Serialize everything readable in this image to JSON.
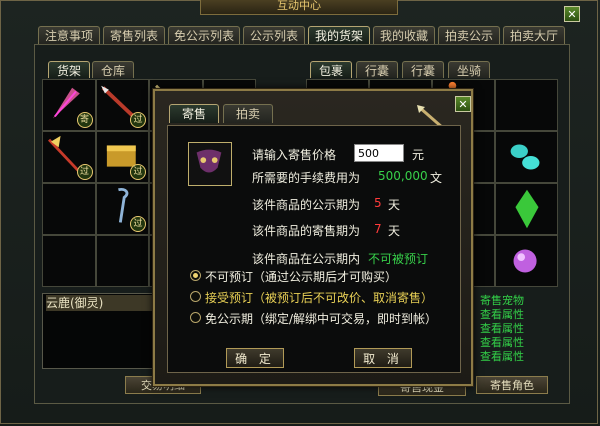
{
  "window": {
    "title": "互动中心",
    "close_icon": "close-x"
  },
  "main_tabs": [
    "注意事项",
    "寄售列表",
    "免公示列表",
    "公示列表",
    "我的货架",
    "我的收藏",
    "拍卖公示",
    "拍卖大厅"
  ],
  "left_tabs": [
    "货架",
    "仓库"
  ],
  "right_tabs": [
    "包裹",
    "行囊",
    "行囊",
    "坐骑"
  ],
  "left_badges": {
    "b0": "寄",
    "b1": "过",
    "b2": "过",
    "b3": "过",
    "b4": "过"
  },
  "pet_list": {
    "item": "云鹿(御灵)"
  },
  "right_links": [
    "寄售宠物",
    "查看属性",
    "查看属性",
    "查看属性",
    "查看属性"
  ],
  "bottom_buttons": {
    "trade_info": "交易明细",
    "consign_money": "寄售现金",
    "consign_role": "寄售角色"
  },
  "modal": {
    "tabs": [
      "寄售",
      "拍卖"
    ],
    "price_label": "请输入寄售价格",
    "price_value": "500",
    "price_unit": "元",
    "fee_label": "所需要的手续费用为",
    "fee_value": "500,000",
    "fee_unit": "文",
    "pub_label": "该件商品的公示期为",
    "pub_value": "5",
    "pub_unit": "天",
    "sell_label": "该件商品的寄售期为",
    "sell_value": "7",
    "sell_unit": "天",
    "preorder_label": "该件商品在公示期内",
    "preorder_value": "不可被预订",
    "options": [
      {
        "label": "不可预订（通过公示期后才可购买）",
        "selected": true,
        "color": "#f1efe0"
      },
      {
        "label": "接受预订（被预订后不可改价、取消寄售）",
        "selected": false,
        "color": "#e7cf55"
      },
      {
        "label": "免公示期（绑定/解绑中可交易，即时到帐）",
        "selected": false,
        "color": "#f1efe0"
      }
    ],
    "confirm": "确 定",
    "cancel": "取 消"
  },
  "colors": {
    "accent_gold": "#8d7b46",
    "green": "#37d04a",
    "red": "#ff3b3b"
  }
}
